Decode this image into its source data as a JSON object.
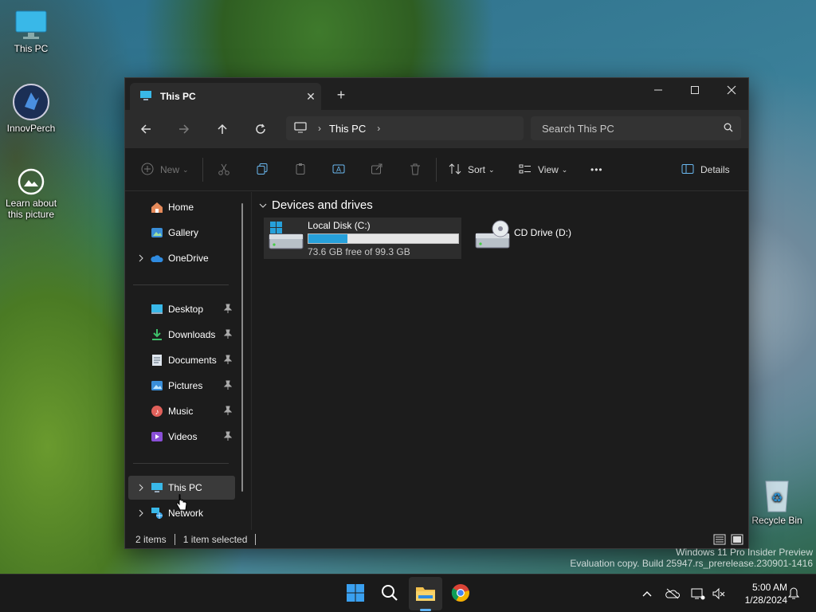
{
  "desktop": {
    "icons": [
      {
        "label": "This PC"
      },
      {
        "label": "InnovPerch"
      },
      {
        "label": "Learn about this picture"
      },
      {
        "label": "Recycle Bin"
      }
    ],
    "watermark": [
      "Windows 11 Pro Insider Preview",
      "Evaluation copy. Build 25947.rs_prerelease.230901-1416"
    ]
  },
  "window": {
    "tab_title": "This PC",
    "address": {
      "crumbs": [
        "This PC"
      ]
    },
    "search": {
      "placeholder": "Search This PC"
    },
    "toolbar": {
      "new_label": "New",
      "sort_label": "Sort",
      "view_label": "View",
      "more_label": "•••",
      "details_label": "Details"
    },
    "nav": {
      "home": "Home",
      "gallery": "Gallery",
      "onedrive": "OneDrive",
      "desktop": "Desktop",
      "downloads": "Downloads",
      "documents": "Documents",
      "pictures": "Pictures",
      "music": "Music",
      "videos": "Videos",
      "thispc": "This PC",
      "network": "Network"
    },
    "content": {
      "group_title": "Devices and drives",
      "drives": [
        {
          "name": "Local Disk (C:)",
          "free_text": "73.6 GB free of 99.3 GB",
          "used_fraction": 0.259
        },
        {
          "name": "CD Drive (D:)"
        }
      ]
    },
    "status": {
      "items": "2 items",
      "selected": "1 item selected"
    }
  },
  "taskbar": {
    "time": "5:00 AM",
    "date": "1/28/2024",
    "icons": [
      "start-icon",
      "search-icon",
      "file-explorer-icon",
      "chrome-icon"
    ]
  },
  "colors": {
    "accent": "#26a0da",
    "window_bg": "#1c1c1c",
    "toolbar_bg": "#2c2c2c"
  }
}
